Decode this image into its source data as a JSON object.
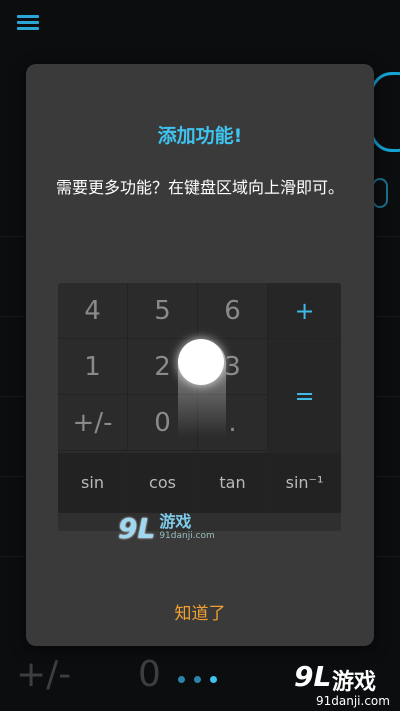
{
  "background": {
    "bottom_keys": [
      "+/-",
      "0"
    ],
    "pager_dots": 3,
    "active_dot": 2
  },
  "dialog": {
    "title": "添加功能!",
    "message": "需要更多功能？在键盘区域向上滑即可。",
    "keypad": {
      "row1": [
        "4",
        "5",
        "6",
        "+"
      ],
      "row2": [
        "1",
        "2",
        "3"
      ],
      "row3": [
        "+/-",
        "0",
        "."
      ],
      "equals": "=",
      "sci": [
        "sin",
        "cos",
        "tan",
        "sin⁻¹"
      ]
    },
    "ok_label": "知道了"
  },
  "watermark": {
    "logo": "9L",
    "name": "游戏",
    "url": "91danji.com"
  },
  "colors": {
    "accent": "#3fc3ef",
    "ok": "#f0a030",
    "dialog_bg": "#3a3a3a"
  }
}
